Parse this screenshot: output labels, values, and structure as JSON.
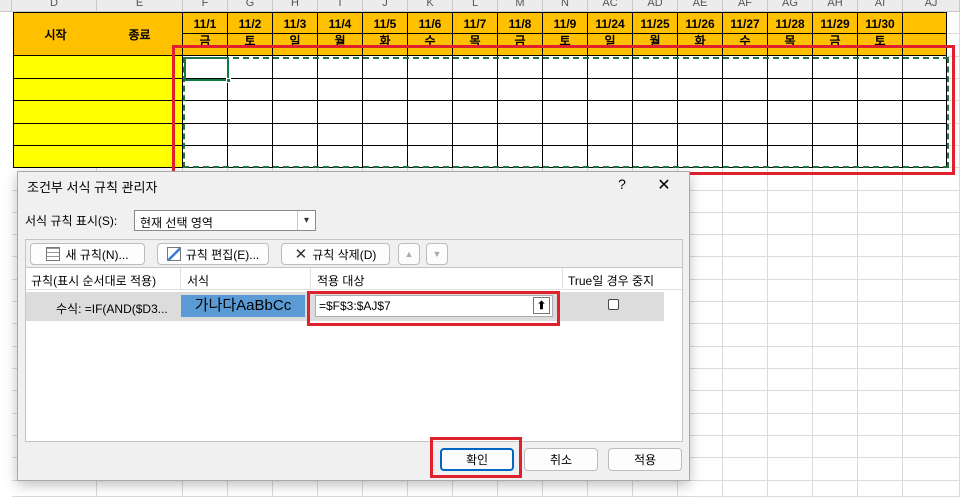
{
  "sheet": {
    "col_letters": [
      "D",
      "E",
      "F",
      "G",
      "H",
      "I",
      "J",
      "K",
      "L",
      "M",
      "N",
      "AC",
      "AD",
      "AE",
      "AF",
      "AG",
      "AH",
      "AI",
      "AJ"
    ],
    "headers": {
      "start": "시작",
      "end": "종료"
    },
    "dates": [
      "11/1",
      "11/2",
      "11/3",
      "11/4",
      "11/5",
      "11/6",
      "11/7",
      "11/8",
      "11/9",
      "11/24",
      "11/25",
      "11/26",
      "11/27",
      "11/28",
      "11/29",
      "11/30"
    ],
    "weekdays": [
      "금",
      "토",
      "일",
      "월",
      "화",
      "수",
      "목",
      "금",
      "토",
      "일",
      "월",
      "화",
      "수",
      "목",
      "금",
      "토"
    ],
    "header_color": "#ffc000",
    "input_color": "#ffff00"
  },
  "dialog": {
    "title": "조건부 서식 규칙 관리자",
    "help": "?",
    "close": "✕",
    "show_rules_label": "서식 규칙 표시(S):",
    "show_rules_value": "현재 선택 영역",
    "new_rule": "새 규칙(N)...",
    "edit_rule": "규칙 편집(E)...",
    "delete_rule": "규칙 삭제(D)",
    "columns": {
      "rule": "규칙(표시 순서대로 적용)",
      "format": "서식",
      "applies_to": "적용 대상",
      "stop_if_true": "True일 경우 중지"
    },
    "rule_row": {
      "rule": "수식: =IF(AND($D3...",
      "format_preview": "가나다AaBbCc",
      "applies_to": "=$F$3:$AJ$7",
      "stop_if_true": false
    },
    "ok": "확인",
    "cancel": "취소",
    "apply": "적용",
    "preview_color": "#5b9bd5"
  }
}
